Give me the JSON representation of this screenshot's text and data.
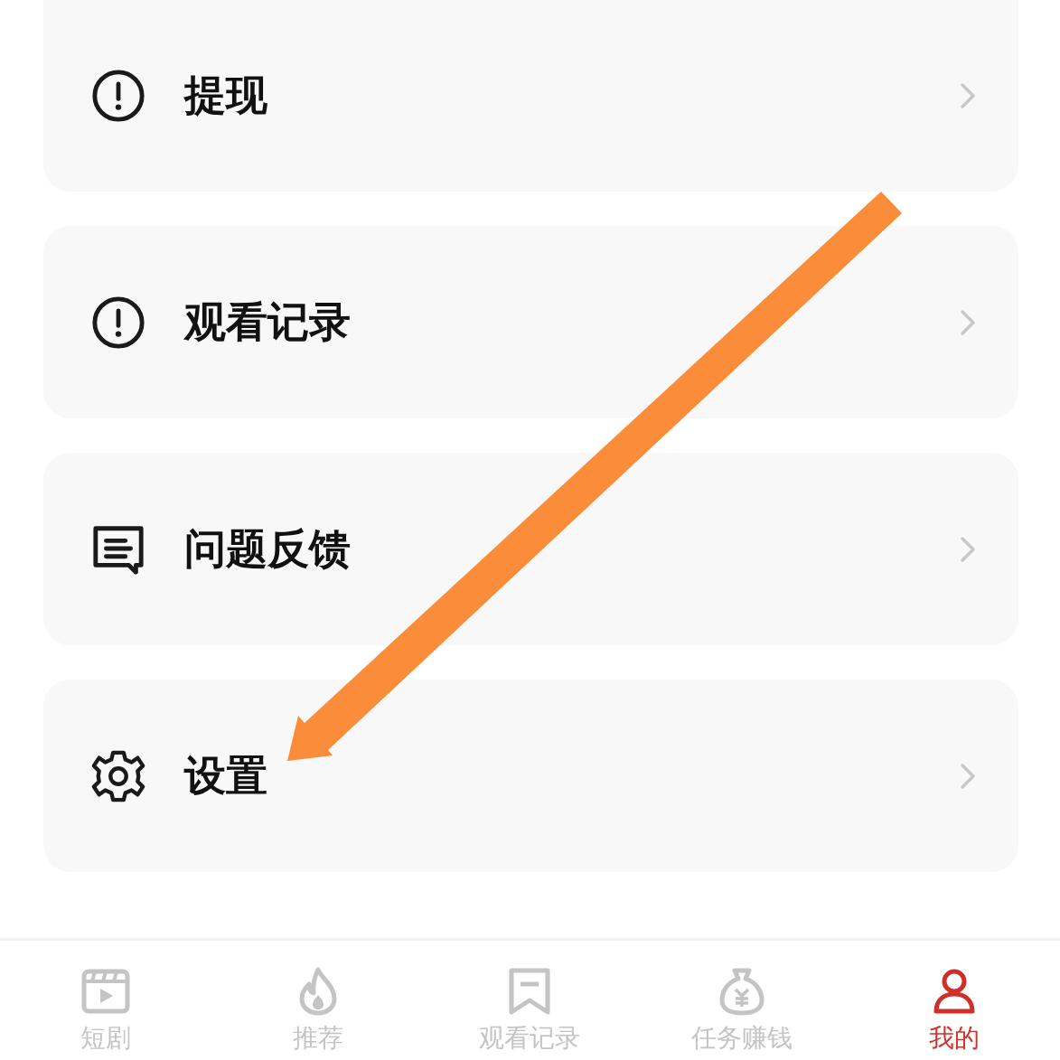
{
  "menu": [
    {
      "kind": "alert",
      "label": "提现"
    },
    {
      "kind": "alert",
      "label": "观看记录"
    },
    {
      "kind": "message",
      "label": "问题反馈"
    },
    {
      "kind": "gear",
      "label": "设置"
    }
  ],
  "tab_bar": [
    {
      "kind": "film",
      "label": "短剧",
      "selected": false
    },
    {
      "kind": "flame",
      "label": "推荐",
      "selected": false
    },
    {
      "kind": "bookmark",
      "label": "观看记录",
      "selected": false
    },
    {
      "kind": "moneybag",
      "label": "任务赚钱",
      "selected": false
    },
    {
      "kind": "person",
      "label": "我的",
      "selected": true
    }
  ]
}
